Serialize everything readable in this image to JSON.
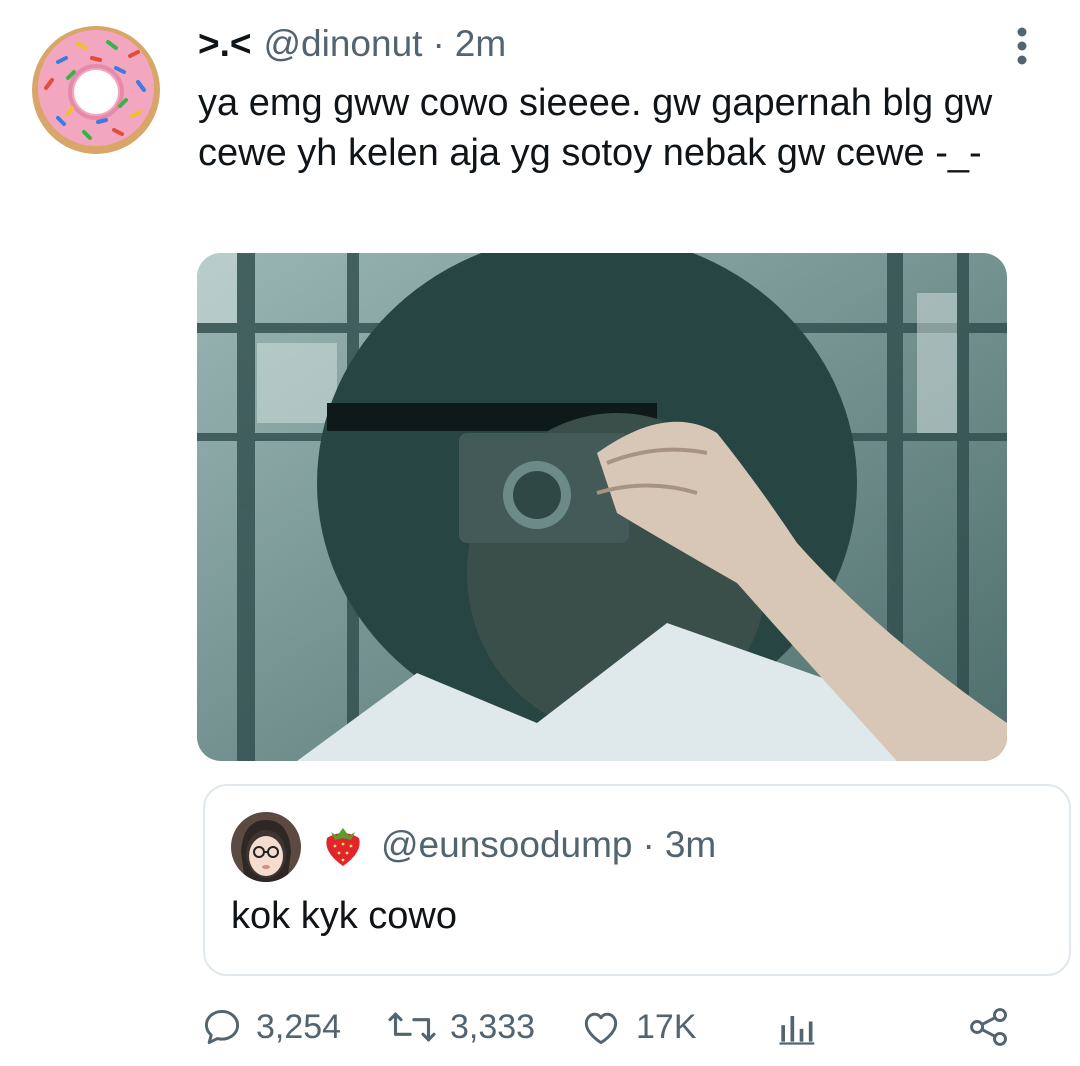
{
  "tweet": {
    "display_name": ">.<",
    "handle": "@dinonut",
    "separator": "·",
    "time": "2m",
    "text": "ya emg gww cowo sieeee. gw gapernah blg gw cewe yh kelen aja yg sotoy nebak gw cewe -_-",
    "avatar_icon": "donut-avatar-icon",
    "more_icon": "more-vertical-icon"
  },
  "quote": {
    "handle": "@eunsoodump",
    "separator": "·",
    "time": "3m",
    "text": "kok kyk cowo",
    "emoji_icon": "strawberry-icon"
  },
  "actions": {
    "replies": "3,254",
    "retweets": "3,333",
    "likes": "17K",
    "reply_icon": "reply-icon",
    "retweet_icon": "retweet-icon",
    "like_icon": "heart-icon",
    "analytics_icon": "analytics-icon",
    "share_icon": "share-icon"
  },
  "colors": {
    "text": "#0f1419",
    "secondary": "#536471",
    "border": "#e1e8ed",
    "donut_frosting": "#f3a6bf"
  }
}
